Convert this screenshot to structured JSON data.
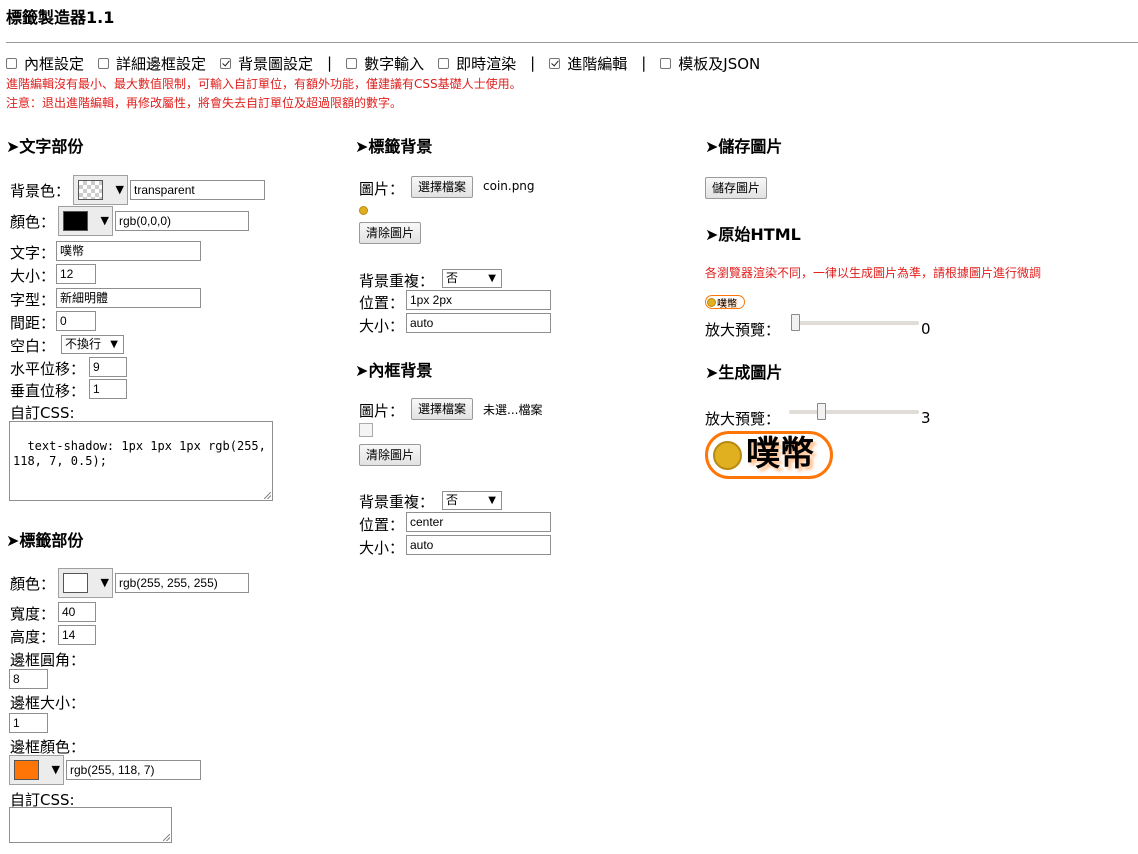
{
  "app": {
    "title": "標籤製造器1.1"
  },
  "options": [
    {
      "label": "內框設定",
      "checked": false
    },
    {
      "label": "詳細邊框設定",
      "checked": false
    },
    {
      "label": "背景圖設定",
      "checked": true
    },
    {
      "label": "數字輸入",
      "checked": false
    },
    {
      "label": "即時渲染",
      "checked": false
    },
    {
      "label": "進階編輯",
      "checked": true
    },
    {
      "label": "模板及JSON",
      "checked": false
    }
  ],
  "separator": "|",
  "warnings": {
    "line1": "進階編輯沒有最小、最大數值限制，可輸入自訂單位，有額外功能，僅建議有CSS基礎人士使用。",
    "line2": "注意：退出進階編輯，再修改屬性，將會失去自訂單位及超過限額的數字。"
  },
  "text_section": {
    "heading": "➤文字部份",
    "bg_label": "背景色：",
    "bg_value": "transparent",
    "color_label": "顏色：",
    "color_value": "rgb(0,0,0)",
    "text_label": "文字：",
    "text_value": "噗幣",
    "size_label": "大小：",
    "size_value": "12",
    "font_label": "字型：",
    "font_value": "新細明體",
    "spacing_label": "間距：",
    "spacing_value": "0",
    "whitespace_label": "空白：",
    "whitespace_value": "不換行",
    "hoffset_label": "水平位移：",
    "hoffset_value": "9",
    "voffset_label": "垂直位移：",
    "voffset_value": "1",
    "css_label": "自訂CSS:",
    "css_value": "text-shadow: 1px 1px 1px rgb(255, 118, 7, 0.5);"
  },
  "tag_section": {
    "heading": "➤標籤部份",
    "color_label": "顏色：",
    "color_value": "rgb(255, 255, 255)",
    "width_label": "寬度：",
    "width_value": "40",
    "height_label": "高度：",
    "height_value": "14",
    "radius_label": "邊框圓角：",
    "radius_value": "8",
    "border_size_label": "邊框大小：",
    "border_size_value": "1",
    "border_color_label": "邊框顏色：",
    "border_color_value": "rgb(255, 118, 7)",
    "css_label": "自訂CSS:",
    "css_value": ""
  },
  "tag_bg": {
    "heading": "➤標籤背景",
    "image_label": "圖片：",
    "choose_button": "選擇檔案",
    "file_name": "coin.png",
    "clear_button": "清除圖片",
    "repeat_label": "背景重複：",
    "repeat_value": "否",
    "position_label": "位置：",
    "position_value": "1px 2px",
    "size_label": "大小：",
    "size_value": "auto"
  },
  "inner_bg": {
    "heading": "➤內框背景",
    "image_label": "圖片：",
    "choose_button": "選擇檔案",
    "file_name": "未選...檔案",
    "clear_button": "清除圖片",
    "repeat_label": "背景重複：",
    "repeat_value": "否",
    "position_label": "位置：",
    "position_value": "center",
    "size_label": "大小：",
    "size_value": "auto"
  },
  "save": {
    "heading": "➤儲存圖片",
    "button": "儲存圖片"
  },
  "raw_html": {
    "heading": "➤原始HTML",
    "note": "各瀏覽器渲染不同，一律以生成圖片為準，請根據圖片進行微調",
    "preview_text": "噗幣",
    "zoom_label": "放大預覽：",
    "zoom_value": "0"
  },
  "generated": {
    "heading": "➤生成圖片",
    "zoom_label": "放大預覽：",
    "zoom_value": "3",
    "preview_text": "噗幣"
  },
  "colors": {
    "warning": "#e0201e",
    "tag_border": "#ff7607",
    "text_color": "#000000",
    "tag_fill": "#ffffff"
  }
}
